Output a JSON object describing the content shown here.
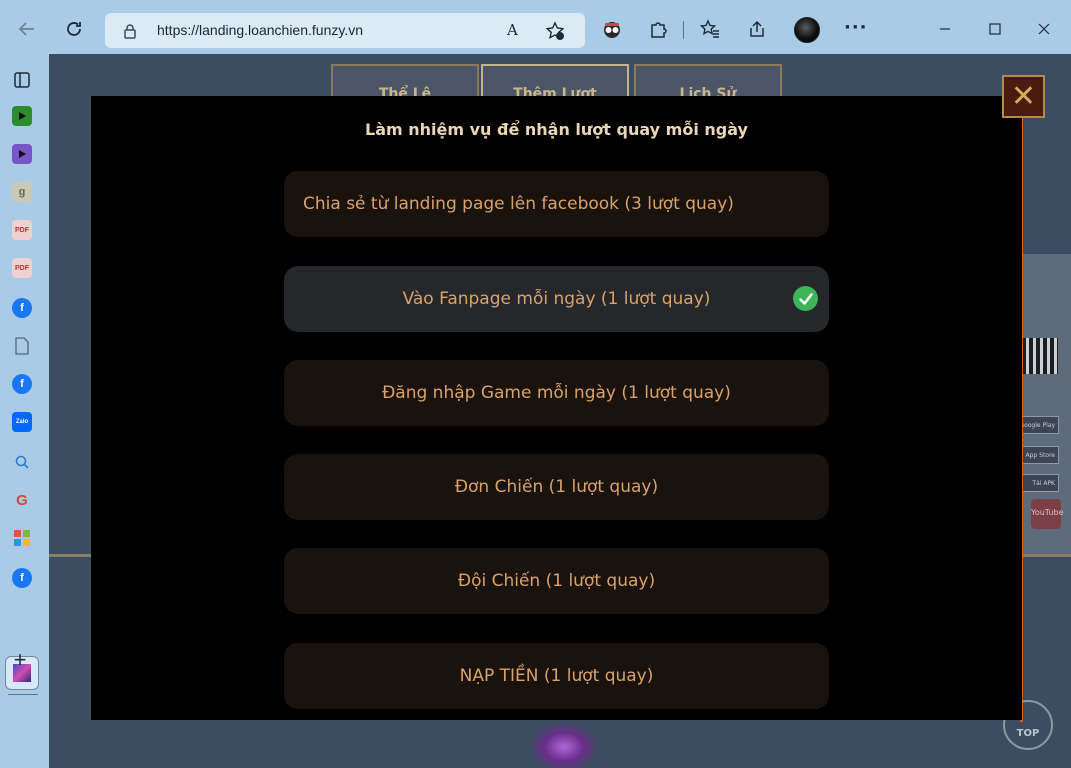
{
  "browser": {
    "url": "https://landing.loanchien.funzy.vn",
    "read_aloud_text": "A"
  },
  "sidebar": {
    "items": [
      {
        "icon": "sidebar-toggle-icon"
      },
      {
        "icon": "play-green-icon",
        "color": "#2e8b2e"
      },
      {
        "icon": "play-purple-icon",
        "color": "#7a55c8"
      },
      {
        "icon": "g-letter-icon",
        "label": "g"
      },
      {
        "icon": "pdf-icon",
        "label": "PDF"
      },
      {
        "icon": "pdf-icon",
        "label": "PDF"
      },
      {
        "icon": "facebook-icon",
        "label": "f"
      },
      {
        "icon": "document-icon"
      },
      {
        "icon": "facebook-icon",
        "label": "f"
      },
      {
        "icon": "zalo-icon",
        "label": "Zalo"
      },
      {
        "icon": "search-icon"
      },
      {
        "icon": "google-icon",
        "label": "G"
      },
      {
        "icon": "microsoft-icon"
      },
      {
        "icon": "facebook-icon",
        "label": "f"
      },
      {
        "icon": "game-tab-icon"
      },
      {
        "icon": "plus-icon",
        "label": "+"
      }
    ]
  },
  "background": {
    "tabs": [
      "Thể Lệ",
      "Thêm Lượt",
      "Lịch Sử"
    ],
    "store_buttons": [
      "Google Play",
      "App Store",
      "Tải APK"
    ],
    "youtube_label": "YouTube",
    "top_button_label": "TOP"
  },
  "modal": {
    "title": "Làm nhiệm vụ để nhận lượt quay mỗi ngày",
    "close_label": "✕",
    "tasks": [
      {
        "label": "Chia sẻ từ landing page lên facebook (3 lượt quay)",
        "completed": false
      },
      {
        "label": "Vào Fanpage mỗi ngày (1 lượt quay)",
        "completed": true
      },
      {
        "label": "Đăng nhập Game mỗi ngày (1 lượt quay)",
        "completed": false
      },
      {
        "label": "Đơn Chiến (1 lượt quay)",
        "completed": false
      },
      {
        "label": "Đội Chiến (1 lượt quay)",
        "completed": false
      },
      {
        "label": "NẠP TIỀN (1 lượt quay)",
        "completed": false
      }
    ]
  },
  "colors": {
    "task_text": "#d9a269",
    "title_text": "#ead5b6",
    "check_green": "#3cb457"
  }
}
